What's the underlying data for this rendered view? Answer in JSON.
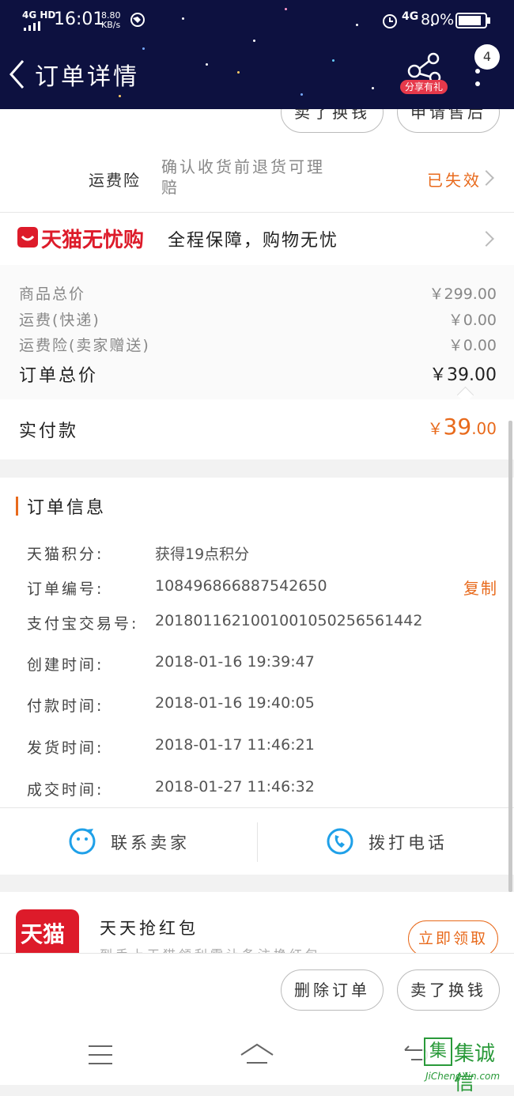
{
  "status_bar": {
    "network": "4G HD",
    "time": "16:01",
    "speed": "8.80 KB/s",
    "battery": "80%",
    "network2": "4G"
  },
  "header": {
    "title": "订单详情",
    "share_label": "分享有礼",
    "badge_count": "4"
  },
  "top_buttons": {
    "left": "卖了换钱",
    "right": "申请售后"
  },
  "insurance": {
    "label": "运费险",
    "desc": "确认收货前退货可理赔",
    "status": "已失效"
  },
  "tmall_worry_free": {
    "logo": "天猫无忧购",
    "text": "全程保障，购物无忧"
  },
  "price": {
    "rows": [
      {
        "label": "商品总价",
        "value": "￥299.00"
      },
      {
        "label": "运费(快递)",
        "value": "￥0.00"
      },
      {
        "label": "运费险(卖家赠送)",
        "value": "￥0.00"
      }
    ],
    "total_label": "订单总价",
    "total_value": "￥39.00",
    "paid_label": "实付款",
    "paid_currency": "￥",
    "paid_int": "39",
    "paid_dec": ".00"
  },
  "order_info": {
    "title": "订单信息",
    "copy_label": "复制",
    "rows": [
      {
        "label": "天猫积分:",
        "value": "获得19点积分"
      },
      {
        "label": "订单编号:",
        "value": "108496866887542650"
      },
      {
        "label": "支付宝交易号:",
        "value": "2018011621001001050256561442"
      },
      {
        "label": "创建时间:",
        "value": "2018-01-16 19:39:47"
      },
      {
        "label": "付款时间:",
        "value": "2018-01-16 19:40:05"
      },
      {
        "label": "发货时间:",
        "value": "2018-01-17 11:46:21"
      },
      {
        "label": "成交时间:",
        "value": "2018-01-27 11:46:32"
      }
    ]
  },
  "contact": {
    "seller": "联系卖家",
    "phone": "拨打电话"
  },
  "promo": {
    "logo": "天猫",
    "title": "天天抢红包",
    "subtitle": "到手上天猫领利需让备注换红包",
    "button": "立即领取"
  },
  "bottom_actions": {
    "delete": "删除订单",
    "sell": "卖了换钱"
  },
  "watermark": {
    "name": "集诚信",
    "url": "JiChengXin.com"
  },
  "colors": {
    "header_bg": "#0d1140",
    "accent": "#e86a1c",
    "tmall_red": "#dd1b2a"
  }
}
